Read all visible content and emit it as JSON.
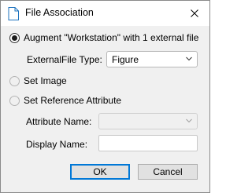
{
  "window": {
    "title": "File Association",
    "icon": "document-icon"
  },
  "options": {
    "augment_label": "Augment \"Workstation\" with 1 external file",
    "set_image_label": "Set Image",
    "set_reference_label": "Set Reference Attribute",
    "selected": "augment"
  },
  "external_file_type": {
    "label": "ExternalFile Type:",
    "value": "Figure"
  },
  "attribute_name": {
    "label": "Attribute Name:",
    "value": ""
  },
  "display_name": {
    "label": "Display Name:",
    "value": ""
  },
  "buttons": {
    "ok": "OK",
    "cancel": "Cancel"
  },
  "colors": {
    "accent": "#0078d7",
    "disabled_text": "#8a8a8a"
  }
}
